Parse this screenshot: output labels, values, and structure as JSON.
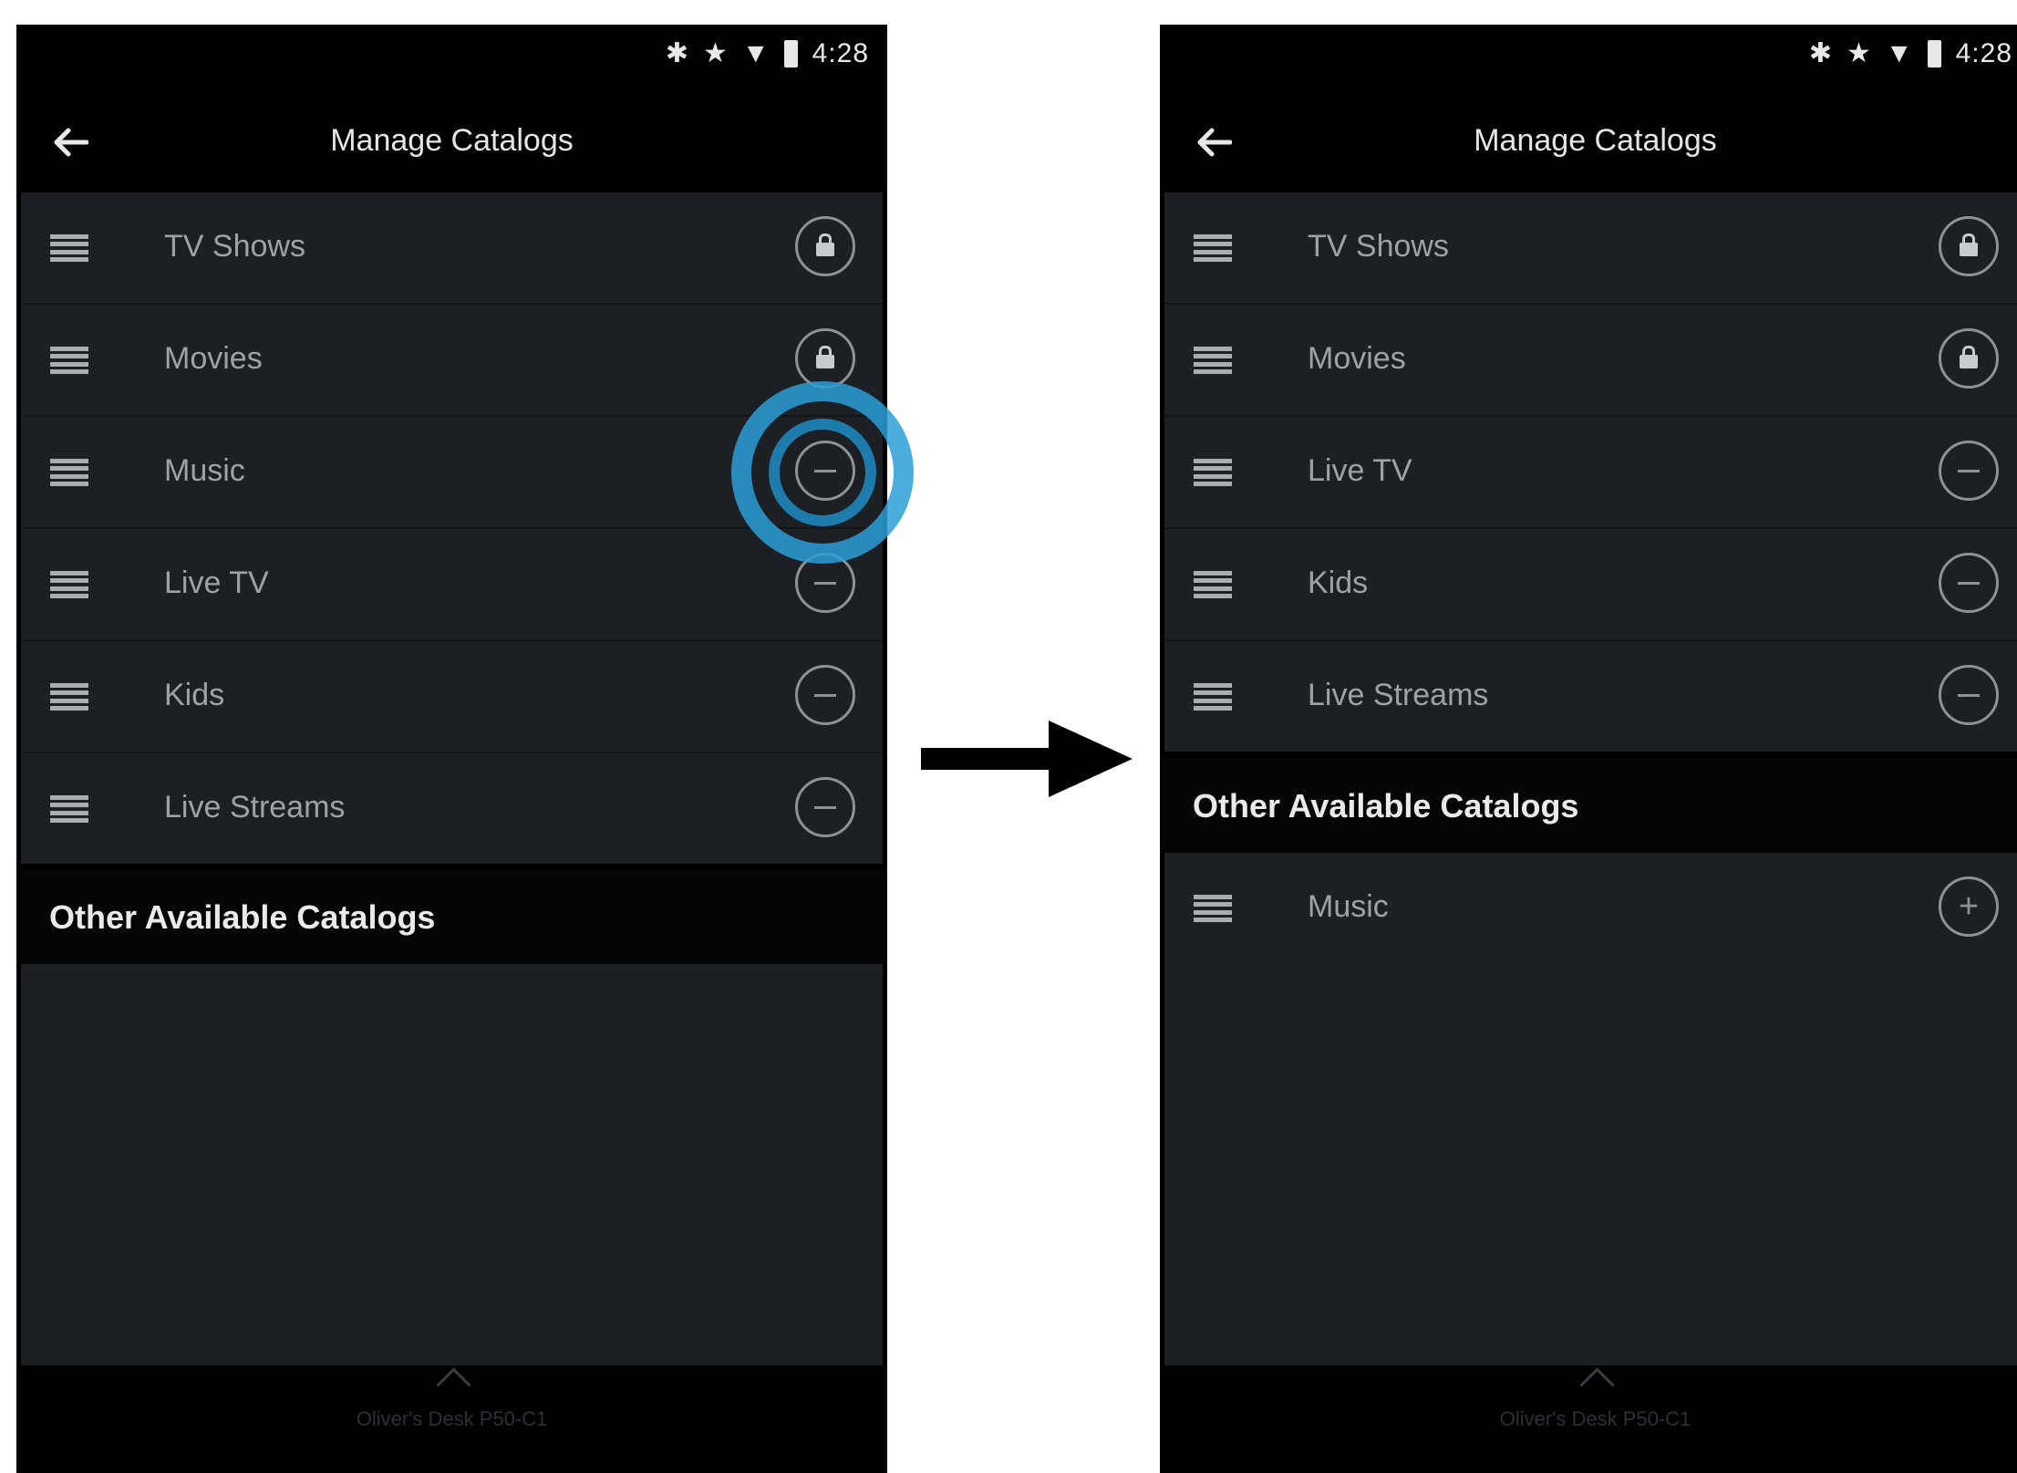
{
  "status_bar": {
    "time": "4:28"
  },
  "screens": {
    "before": {
      "title": "Manage Catalogs",
      "catalogs": [
        "TV Shows",
        "Movies",
        "Music",
        "Live TV",
        "Kids",
        "Live Streams"
      ],
      "section_title": "Other Available Catalogs",
      "footer": {
        "device": "Oliver's Desk P50-C1",
        "sub": ""
      }
    },
    "after": {
      "title": "Manage Catalogs",
      "catalogs": [
        "TV Shows",
        "Movies",
        "Live TV",
        "Kids",
        "Live Streams"
      ],
      "section_title": "Other Available Catalogs",
      "available": [
        "Music"
      ],
      "footer": {
        "device": "Oliver's Desk P50-C1",
        "sub": ""
      }
    }
  },
  "icons": {
    "back": "back-arrow-icon",
    "drag": "drag-handle-icon",
    "locked": "lock-icon",
    "remove": "minus-circle-icon",
    "add": "plus-circle-icon",
    "transition": "right-arrow-icon"
  },
  "colors": {
    "highlight": "#2a9fd6",
    "list_bg": "#1c1f24",
    "screen_bg": "#000000"
  }
}
